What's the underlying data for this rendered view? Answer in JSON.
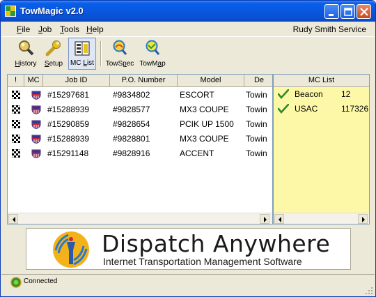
{
  "window": {
    "title": "TowMagic v2.0",
    "title_color": "#0858e0"
  },
  "menu": {
    "items": [
      {
        "first": "F",
        "rest": "ile"
      },
      {
        "first": "J",
        "rest": "ob"
      },
      {
        "first": "T",
        "rest": "ools"
      },
      {
        "first": "H",
        "rest": "elp"
      }
    ],
    "user": "Rudy Smith Service"
  },
  "toolbar": {
    "history": {
      "first": "H",
      "rest": "istory",
      "icon": "magnifier-icon"
    },
    "setup": {
      "first": "S",
      "rest": "etup",
      "icon": "wrench-icon"
    },
    "mc_list": {
      "first": "MC ",
      "u": "L",
      "rest": "ist",
      "icon": "list-icon"
    },
    "towspec": {
      "first": "TowS",
      "u": "p",
      "rest": "ec",
      "icon": "magnifier-plus-icon"
    },
    "towmap": {
      "first": "TowM",
      "u": "a",
      "rest": "p",
      "icon": "magnifier-plus-icon"
    }
  },
  "grid": {
    "columns": [
      "!",
      "MC",
      "Job ID",
      "P.O. Number",
      "Model",
      "De"
    ],
    "rows": [
      {
        "job_id": "#15297681",
        "po": "#9834802",
        "model": "ESCORT",
        "desc": "Towin"
      },
      {
        "job_id": "#15288939",
        "po": "#9828577",
        "model": "MX3 COUPE",
        "desc": "Towin"
      },
      {
        "job_id": "#15290859",
        "po": "#9828654",
        "model": "PCIK UP 1500",
        "desc": "Towin"
      },
      {
        "job_id": "#15288939",
        "po": "#9828801",
        "model": "MX3 COUPE",
        "desc": "Towin"
      },
      {
        "job_id": "#15291148",
        "po": "#9828916",
        "model": "ACCENT",
        "desc": "Towin"
      }
    ]
  },
  "mc_list": {
    "header": "MC List",
    "items": [
      {
        "name": "Beacon",
        "number": "12"
      },
      {
        "name": "USAC",
        "number": "117326"
      }
    ],
    "background": "#fdf8a8"
  },
  "banner": {
    "title": "Dispatch Anywhere",
    "subtitle": "Internet Transportation Management Software"
  },
  "status": {
    "text": "Connected",
    "color": "#22aa22"
  }
}
